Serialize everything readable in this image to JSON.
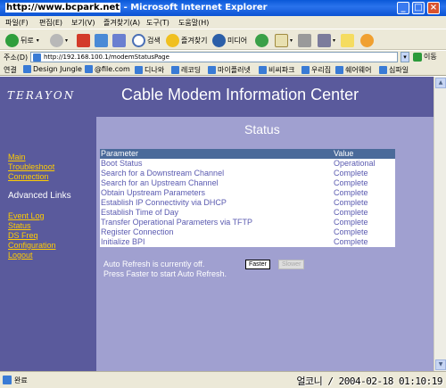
{
  "window": {
    "watermark": "http://www.bcpark.net",
    "title": "- Microsoft Internet Explorer",
    "controls": [
      "_",
      "□",
      "×"
    ]
  },
  "menu": [
    "파일(F)",
    "편집(E)",
    "보기(V)",
    "즐겨찾기(A)",
    "도구(T)",
    "도움말(H)"
  ],
  "toolbar": {
    "back": "뒤로",
    "search": "검색",
    "favorites": "즐겨찾기",
    "media": "미디어"
  },
  "address": {
    "label": "주소(D)",
    "url": "http://192.168.100.1/modemStatusPage",
    "go": "이동"
  },
  "links": {
    "label": "연결",
    "items": [
      "Design Jungle",
      "@file.com",
      "디나와",
      "레코딩",
      "마이플러넷",
      "비씨파크",
      "우리집",
      "쉐어웨어",
      "심파일"
    ]
  },
  "page": {
    "logo": "TERAYON",
    "header_title": "Cable Modem Information Center",
    "sidebar": {
      "top_links": [
        "Main",
        "Troubleshoot",
        "Connection"
      ],
      "advanced_heading": "Advanced Links",
      "bottom_links": [
        "Event Log",
        "Status",
        "DS Freq",
        "Configuration",
        "Logout"
      ]
    },
    "status_title": "Status",
    "table": {
      "headers": [
        "Parameter",
        "Value"
      ],
      "rows": [
        [
          "Boot Status",
          "Operational"
        ],
        [
          "Search for a Downstream Channel",
          "Complete"
        ],
        [
          "Search for an Upstream Channel",
          "Complete"
        ],
        [
          "Obtain Upstream Parameters",
          "Complete"
        ],
        [
          "Establish IP Connectivity via DHCP",
          "Complete"
        ],
        [
          "Establish Time of Day",
          "Complete"
        ],
        [
          "Transfer Operational Parameters via TFTP",
          "Complete"
        ],
        [
          "Register Connection",
          "Complete"
        ],
        [
          "Initialize BPI",
          "Complete"
        ]
      ]
    },
    "refresh_line1": "Auto Refresh is currently off.",
    "refresh_line2": "Press Faster to start Auto Refresh.",
    "faster_label": "Faster",
    "slower_label": "Slower"
  },
  "statusbar": {
    "text": "완료",
    "stamp": "얼코니 / 2004-02-18 01:10:19"
  },
  "colors": {
    "header_band": "#5a5a9c",
    "main_bg": "#a0a0d0",
    "link": "#ffcc00",
    "table_header": "#4a6a9a",
    "table_text": "#5a5ab0"
  }
}
